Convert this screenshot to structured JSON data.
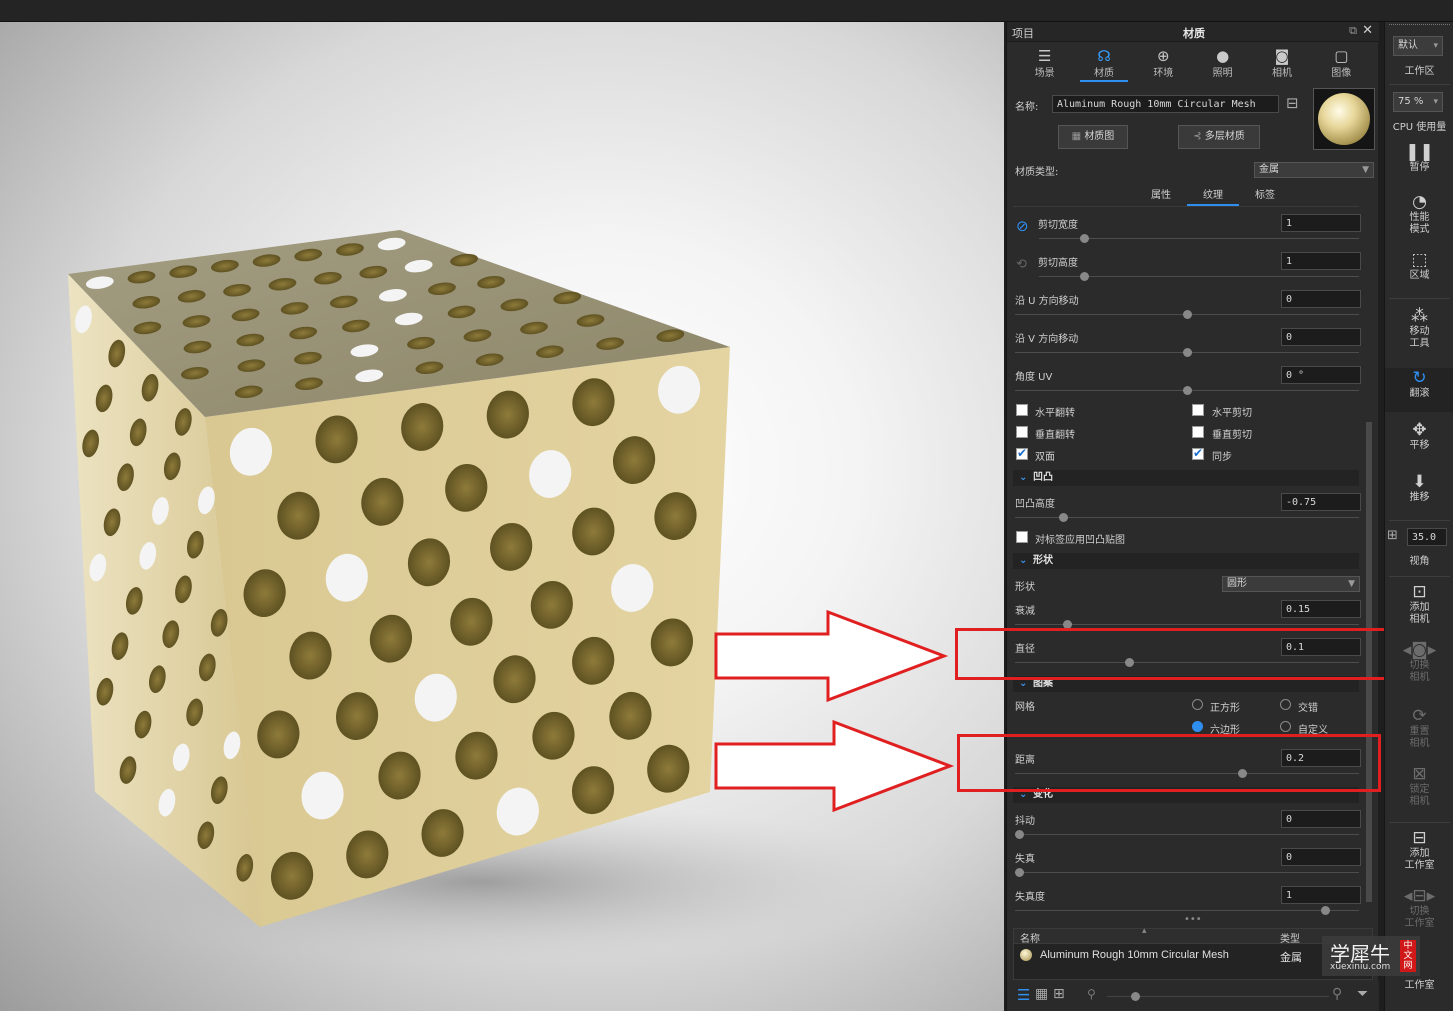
{
  "panel": {
    "title_left": "项目",
    "title_center": "材质",
    "tabs": [
      {
        "label": "场景",
        "icon": "scene-icon"
      },
      {
        "label": "材质",
        "icon": "material-icon"
      },
      {
        "label": "环境",
        "icon": "environment-icon"
      },
      {
        "label": "照明",
        "icon": "lighting-icon"
      },
      {
        "label": "相机",
        "icon": "camera-icon"
      },
      {
        "label": "图像",
        "icon": "image-icon"
      }
    ],
    "name_label": "名称:",
    "name_value": "Aluminum Rough 10mm Circular Mesh",
    "material_graph_btn": "材质图",
    "multilayer_btn": "多层材质",
    "type_label": "材质类型:",
    "type_value": "金属",
    "subtabs": [
      "属性",
      "纹理",
      "标签"
    ],
    "params": {
      "cut_width": {
        "label": "剪切宽度",
        "value": "1",
        "level": 0.14
      },
      "cut_height": {
        "label": "剪切高度",
        "value": "1",
        "level": 0.14
      },
      "u_shift": {
        "label": "沿 U 方向移动",
        "value": "0",
        "level": 0.5
      },
      "v_shift": {
        "label": "沿 V 方向移动",
        "value": "0",
        "level": 0.5
      },
      "angle_uv": {
        "label": "角度 UV",
        "value": "0 °",
        "level": 0.5
      }
    },
    "checkboxes": {
      "hflip": "水平翻转",
      "hcut": "水平剪切",
      "vflip": "垂直翻转",
      "vcut": "垂直剪切",
      "double": "双面",
      "sync": "同步"
    },
    "section_bump": "凹凸",
    "bump_height": {
      "label": "凹凸高度",
      "value": "-0.75",
      "level": 0.14
    },
    "bump_on_label": "对标签应用凹凸贴图",
    "section_shape": "形状",
    "shape_label": "形状",
    "shape_value": "圆形",
    "falloff": {
      "label": "衰减",
      "value": "0.15",
      "level": 0.15
    },
    "diameter": {
      "label": "直径",
      "value": "0.1",
      "level": 0.33
    },
    "section_pattern": "图案",
    "grid_label": "网格",
    "grid_square": "正方形",
    "grid_stagger": "交错",
    "grid_hex": "六边形",
    "grid_custom": "自定义",
    "distance": {
      "label": "距离",
      "value": "0.2",
      "level": 0.66
    },
    "section_variation": "变化",
    "jitter": {
      "label": "抖动",
      "value": "0",
      "level": 0.0
    },
    "distort": {
      "label": "失真",
      "value": "0",
      "level": 0.0
    },
    "distort_scale": {
      "label": "失真度",
      "value": "1",
      "level": 0.9
    },
    "list_header_name": "名称",
    "list_header_type": "类型",
    "list_row_name": "Aluminum Rough 10mm Circular Mesh",
    "list_row_type": "金属"
  },
  "rightbar": {
    "workspace_select": "默认",
    "workspace_label": "工作区",
    "cpu_select": "75 %",
    "cpu_label": "CPU 使用量",
    "pause": "暂停",
    "perf_mode": "性能\n模式",
    "region": "区域",
    "move_tool": "移动\n工具",
    "tumble": "翻滚",
    "pan": "平移",
    "dolly": "推移",
    "fov_value": "35.0",
    "fov_label": "视角",
    "add_camera": "添加\n相机",
    "switch_camera": "切换\n相机",
    "reset_camera": "重置\n相机",
    "lock_camera": "锁定\n相机",
    "add_studio": "添加\n工作室",
    "switch_studio": "切换\n工作室",
    "studio": "工作室"
  },
  "watermark": {
    "main": "学犀牛",
    "sub": "xuexiniu.com",
    "badge": "中文网"
  },
  "colors": {
    "accent": "#2f8ff0",
    "highlight_box": "#e02020",
    "arrow": "#e02020"
  }
}
